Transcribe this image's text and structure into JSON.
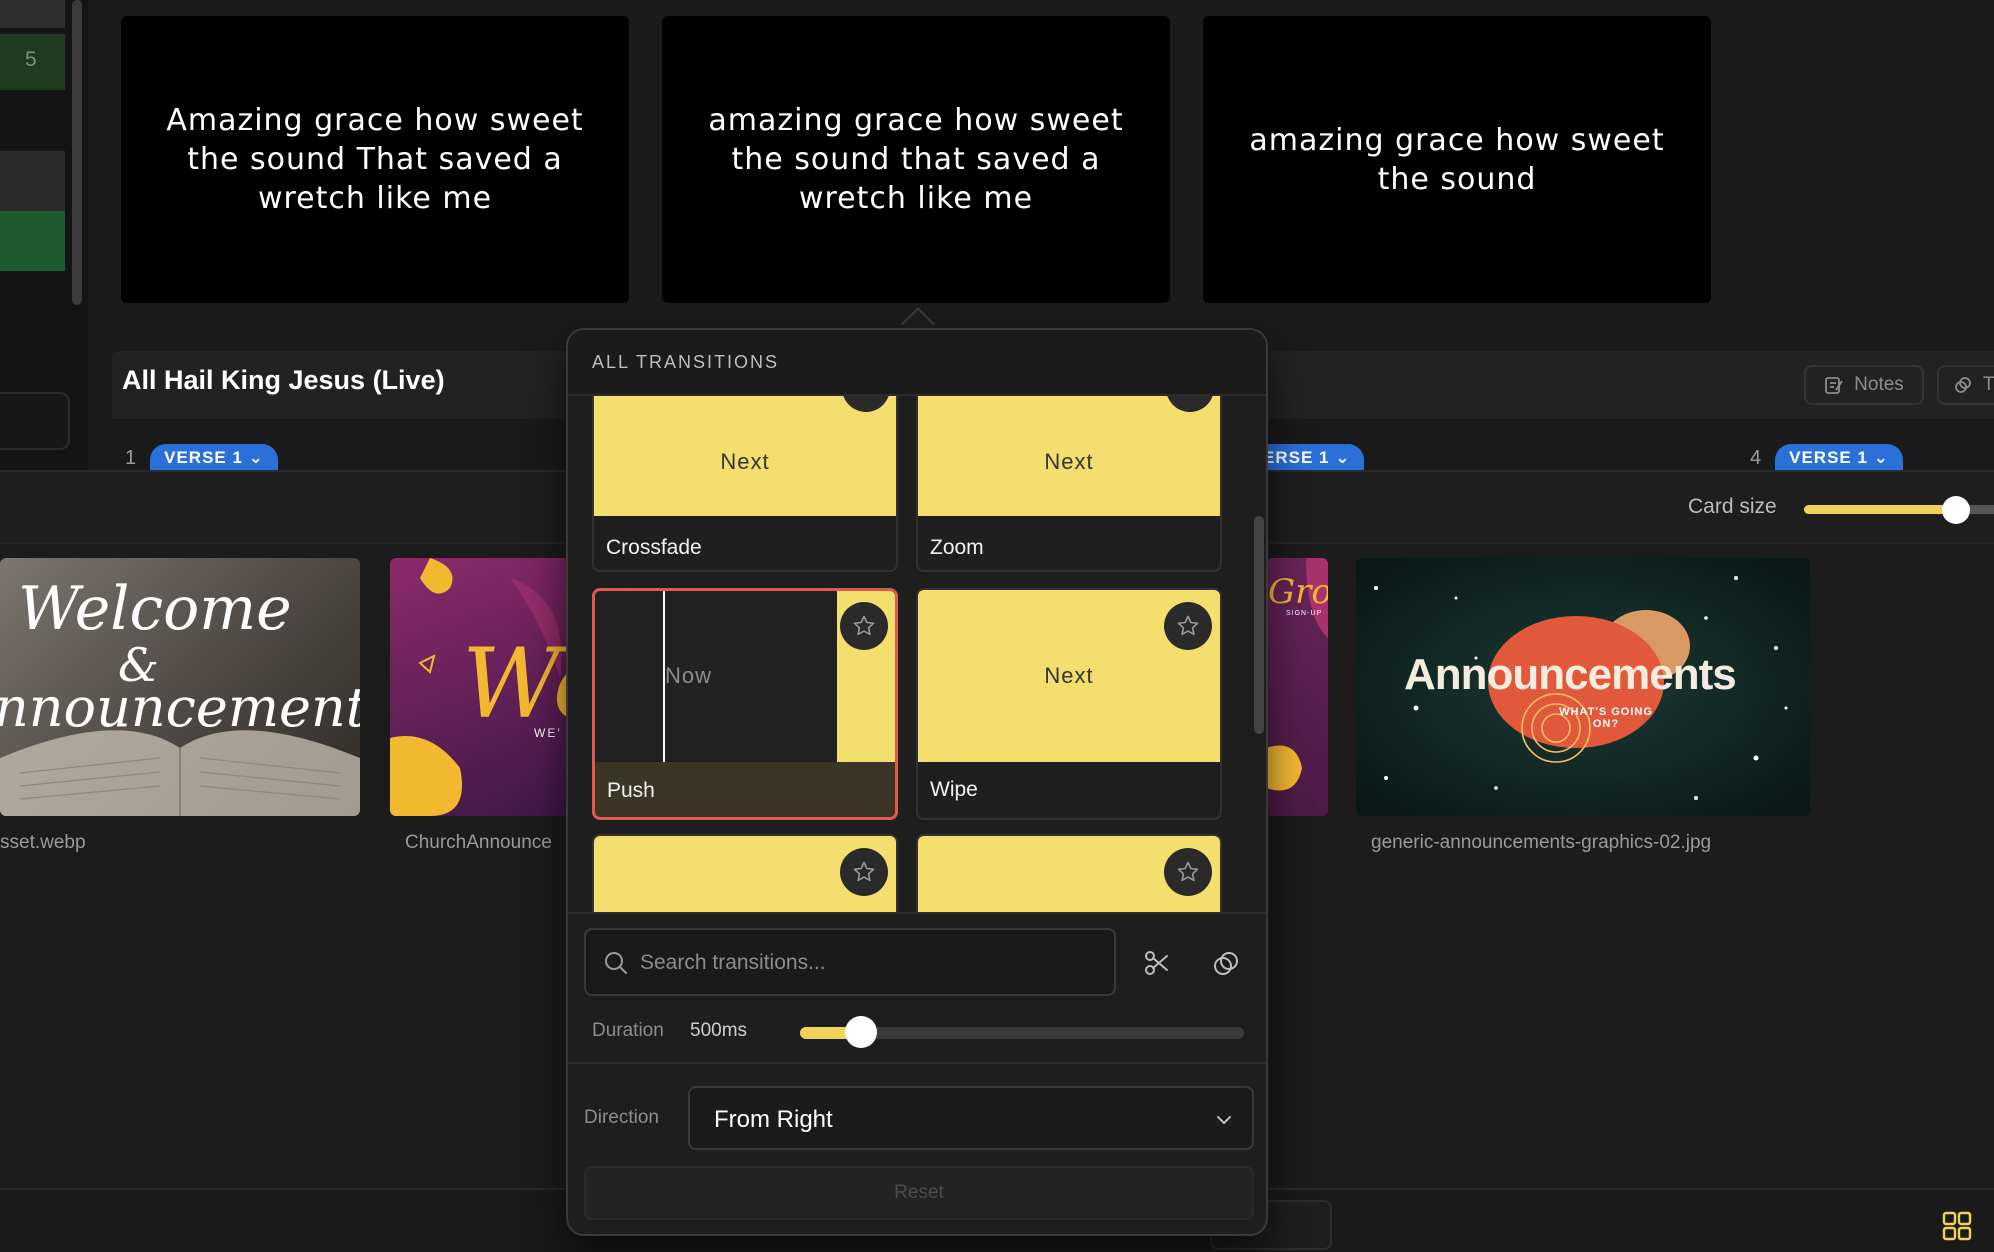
{
  "left_strip": {
    "row_number": "5"
  },
  "slides": [
    {
      "text": "Amazing grace how sweet\nthe sound That saved a\nwretch like me"
    },
    {
      "text": "amazing grace how sweet\nthe sound that saved a\nwretch like me"
    },
    {
      "text": "amazing grace how sweet\nthe sound"
    }
  ],
  "song": {
    "title": "All Hail King Jesus (Live)",
    "notes_label": "Notes",
    "second_button_label": "T",
    "verses": [
      {
        "number": "1",
        "label": "VERSE 1 ⌄"
      },
      {
        "number": "",
        "label": "ERSE 1 ⌄"
      },
      {
        "number": "4",
        "label": "VERSE 1 ⌄"
      }
    ]
  },
  "media_bin": {
    "card_size_label": "Card size",
    "card_size_value": 0.8,
    "items": [
      {
        "label": "sset.webp",
        "title": "Welcome",
        "subtitle": "&",
        "title2": "nnouncements"
      },
      {
        "label": "ChurchAnnounce",
        "title": "We",
        "subtitle": "WE'"
      },
      {
        "label": "",
        "title": "Grou",
        "subtitle": "SIGN-UP"
      },
      {
        "label": "generic-announcements-graphics-02.jpg",
        "title": "Announcements",
        "subtitle": "WHAT'S GOING ON?"
      }
    ]
  },
  "transitions": {
    "header": "ALL TRANSITIONS",
    "items": [
      {
        "name": "Crossfade",
        "preview_text": "Next",
        "selected": false
      },
      {
        "name": "Zoom",
        "preview_text": "Next",
        "selected": false
      },
      {
        "name": "Push",
        "preview_text": "Now",
        "selected": true
      },
      {
        "name": "Wipe",
        "preview_text": "Next",
        "selected": false
      },
      {
        "name": "",
        "preview_text": "",
        "selected": false
      },
      {
        "name": "",
        "preview_text": "",
        "selected": false
      }
    ],
    "search_placeholder": "Search transitions...",
    "duration_label": "Duration",
    "duration_value": "500ms",
    "duration_fraction": 0.12,
    "direction_label": "Direction",
    "direction_value": "From Right",
    "reset_label": "Reset"
  },
  "colors": {
    "accent_yellow": "#f4df6e",
    "selected_red": "#e05a4c",
    "verse_blue": "#2b6fd9"
  }
}
